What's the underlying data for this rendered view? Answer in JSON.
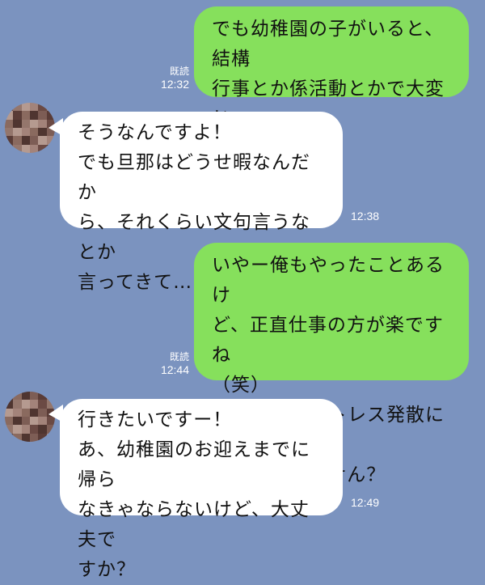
{
  "messages": [
    {
      "direction": "outgoing",
      "text": "でも幼稚園の子がいると、結構\n行事とか係活動とかで大変じゃ\nないです？",
      "read_label": "既読",
      "time": "12:32"
    },
    {
      "direction": "incoming",
      "text": "そうなんですよ！\nでも旦那はどうせ暇なんだか\nら、それくらい文句言うなとか\n言ってきて…",
      "time": "12:38"
    },
    {
      "direction": "outgoing",
      "text": "いやー俺もやったことあるけ\nど、正直仕事の方が楽ですね\n（笑）\n良かったらストレス発散にラン\nチでも行きません？",
      "read_label": "既読",
      "time": "12:44"
    },
    {
      "direction": "incoming",
      "text": "行きたいですー！\nあ、幼稚園のお迎えまでに帰ら\nなきゃならないけど、大丈夫で\nすか？",
      "time": "12:49"
    }
  ],
  "colors": {
    "background": "#7b93bf",
    "outgoing_bubble": "#86e05c",
    "incoming_bubble": "#ffffff",
    "meta_text": "#ffffff"
  },
  "avatar_icon": "pixelated-avatar-icon"
}
